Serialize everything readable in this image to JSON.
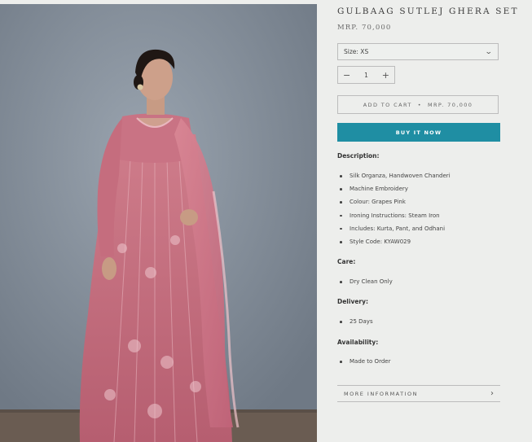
{
  "product": {
    "title": "GULBAAG SUTLEJ GHERA SET",
    "price": "MRP. 70,000"
  },
  "size_select": {
    "value": "Size: XS",
    "icon": "chevron-down-icon"
  },
  "quantity": {
    "minus": "−",
    "value": "1",
    "plus": "+"
  },
  "add_to_cart": {
    "label": "ADD TO CART",
    "separator": "•",
    "price": "MRP. 70,000"
  },
  "buy_now": {
    "label": "BUY IT NOW",
    "color": "#1f8ea3"
  },
  "description": {
    "heading": "Description:",
    "items": [
      "Silk Organza, Handwoven Chanderi",
      "Machine Embroidery",
      "Colour: Grapes Pink",
      "Ironing Instructions: Steam Iron",
      "Includes: Kurta, Pant, and Odhani",
      "Style Code: KYAW029"
    ]
  },
  "care": {
    "heading": "Care:",
    "items": [
      "Dry Clean Only"
    ]
  },
  "delivery": {
    "heading": "Delivery:",
    "items": [
      "25 Days"
    ]
  },
  "availability": {
    "heading": "Availability:",
    "items": [
      "Made to Order"
    ]
  },
  "more_info": {
    "label": "MORE INFORMATION",
    "icon": "chevron-right-icon"
  },
  "colors": {
    "accent": "#1f8ea3",
    "outfit_pink": "#c46c7d",
    "background_wall": "#838d99"
  }
}
